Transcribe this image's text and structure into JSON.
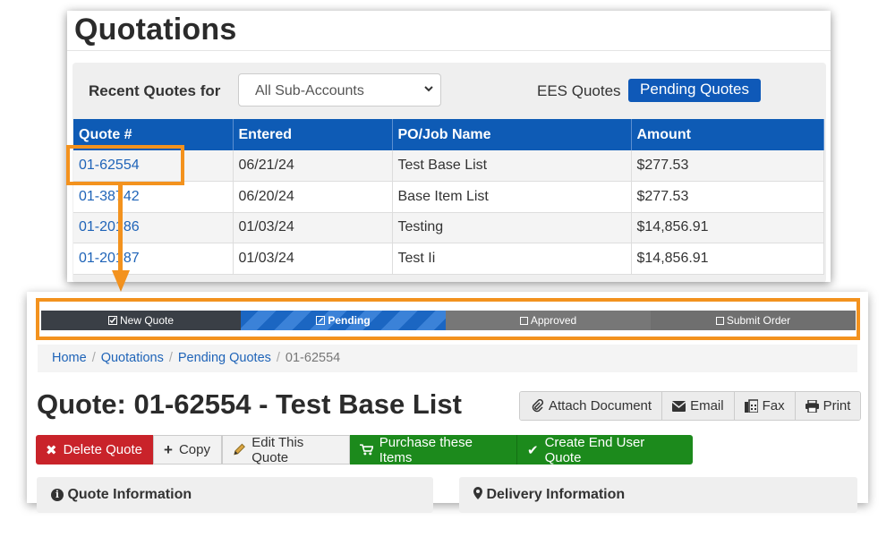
{
  "top": {
    "title": "Quotations",
    "recent_label": "Recent Quotes for",
    "subaccount_select": "All Sub-Accounts",
    "tab_ees": "EES Quotes",
    "tab_pending": "Pending Quotes",
    "columns": [
      "Quote #",
      "Entered",
      "PO/Job Name",
      "Amount"
    ],
    "rows": [
      [
        "01-62554",
        "06/21/24",
        "Test Base List",
        "$277.53"
      ],
      [
        "01-38742",
        "06/20/24",
        "Base Item List",
        "$277.53"
      ],
      [
        "01-20186",
        "01/03/24",
        "Testing",
        "$14,856.91"
      ],
      [
        "01-20187",
        "01/03/24",
        "Test Ii",
        "$14,856.91"
      ]
    ]
  },
  "steps": [
    "New Quote",
    "Pending",
    "Approved",
    "Submit Order"
  ],
  "breadcrumb": {
    "home": "Home",
    "quotations": "Quotations",
    "pending": "Pending Quotes",
    "current": "01-62554"
  },
  "quote_title": "Quote: 01-62554 - Test Base List",
  "toolbar": {
    "attach": "Attach Document",
    "email": "Email",
    "fax": "Fax",
    "print": "Print"
  },
  "actions": {
    "delete": "Delete Quote",
    "copy": "Copy",
    "edit": "Edit This Quote",
    "purchase": "Purchase these Items",
    "end_user": "Create End User Quote"
  },
  "sections": {
    "quote_info": "Quote Information",
    "delivery_info": "Delivery Information"
  },
  "colors": {
    "accent": "#0e5bb5",
    "highlight": "#f3921e",
    "danger": "#c9232a",
    "success": "#1c8a1c"
  }
}
